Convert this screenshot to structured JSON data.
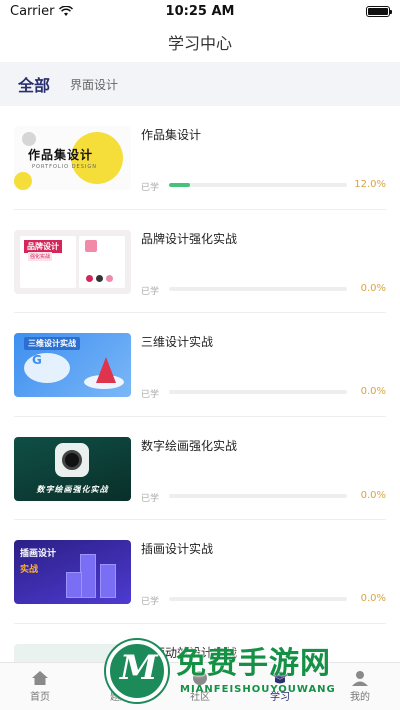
{
  "status_bar": {
    "carrier": "Carrier",
    "time": "10:25 AM"
  },
  "header": {
    "title": "学习中心"
  },
  "tabs": [
    {
      "label": "全部",
      "active": true
    },
    {
      "label": "界面设计",
      "active": false
    }
  ],
  "courses": [
    {
      "title": "作品集设计",
      "learned_label": "已学",
      "progress": 0.12,
      "percent_text": "12.0%",
      "thumb": {
        "title": "作品集设计",
        "subtitle": "PORTFOLIO DESIGN"
      }
    },
    {
      "title": "品牌设计强化实战",
      "learned_label": "已学",
      "progress": 0.0,
      "percent_text": "0.0%",
      "thumb": {
        "title": "品牌设计",
        "subtitle": "强化实战"
      }
    },
    {
      "title": "三维设计实战",
      "learned_label": "已学",
      "progress": 0.0,
      "percent_text": "0.0%",
      "thumb": {
        "title": "三维设计实战",
        "icon": "G"
      }
    },
    {
      "title": "数字绘画强化实战",
      "learned_label": "已学",
      "progress": 0.0,
      "percent_text": "0.0%",
      "thumb": {
        "title": "数字绘画强化实战"
      }
    },
    {
      "title": "插画设计实战",
      "learned_label": "已学",
      "progress": 0.0,
      "percent_text": "0.0%",
      "thumb": {
        "title": "插画设计",
        "subtitle": "实战"
      }
    },
    {
      "title": "界面动效设计实战",
      "learned_label": "",
      "progress": null,
      "percent_text": "",
      "thumb": {
        "title": ""
      }
    }
  ],
  "tabbar": [
    {
      "label": "首页",
      "icon": "home-icon",
      "active": false
    },
    {
      "label": "题库",
      "icon": "question-bank-icon",
      "active": false
    },
    {
      "label": "社区",
      "icon": "community-icon",
      "active": false
    },
    {
      "label": "学习",
      "icon": "graduation-cap-icon",
      "active": true
    },
    {
      "label": "我的",
      "icon": "profile-icon",
      "active": false
    }
  ],
  "watermark": {
    "title": "免费手游网",
    "subtitle": "MIANFEISHOUYOUWANG",
    "logo_letter": "M"
  },
  "colors": {
    "accent": "#2a2f6e",
    "progress": "#46c27a",
    "percent": "#d9a441",
    "tab_bg": "#f3f4f8",
    "watermark": "#159145"
  }
}
